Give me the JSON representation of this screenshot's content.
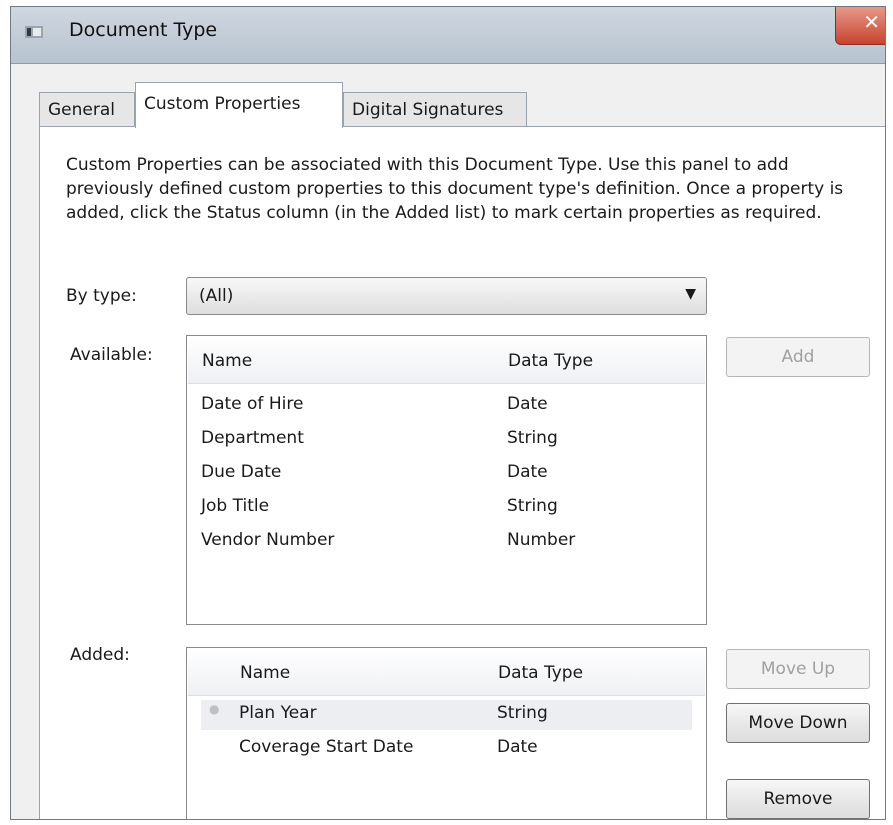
{
  "window": {
    "title": "Document Type"
  },
  "tabs": [
    {
      "label": "General"
    },
    {
      "label": "Custom Properties"
    },
    {
      "label": "Digital Signatures"
    }
  ],
  "description": "Custom Properties can be associated with this Document Type.  Use this panel to add previously defined custom properties to this document type's definition.  Once a property is added, click the Status column (in the Added list) to mark certain properties as required.",
  "by_type": {
    "label": "By type:",
    "value": "(All)"
  },
  "available": {
    "label": "Available:",
    "columns": [
      "Name",
      "Data Type"
    ],
    "rows": [
      [
        "Date of Hire",
        "Date"
      ],
      [
        "Department",
        "String"
      ],
      [
        "Due Date",
        "Date"
      ],
      [
        "Job Title",
        "String"
      ],
      [
        "Vendor Number",
        "Number"
      ]
    ]
  },
  "added": {
    "label": "Added:",
    "columns": [
      "Name",
      "Data Type"
    ],
    "rows": [
      [
        "Plan Year",
        "String"
      ],
      [
        "Coverage Start Date",
        "Date"
      ]
    ]
  },
  "buttons": {
    "add": "Add",
    "move_up": "Move Up",
    "move_down": "Move Down",
    "remove": "Remove"
  },
  "colors": {
    "title_bar": "#b7c3d0",
    "close_button": "#c7432e",
    "disabled_text": "#a0a0a0"
  }
}
